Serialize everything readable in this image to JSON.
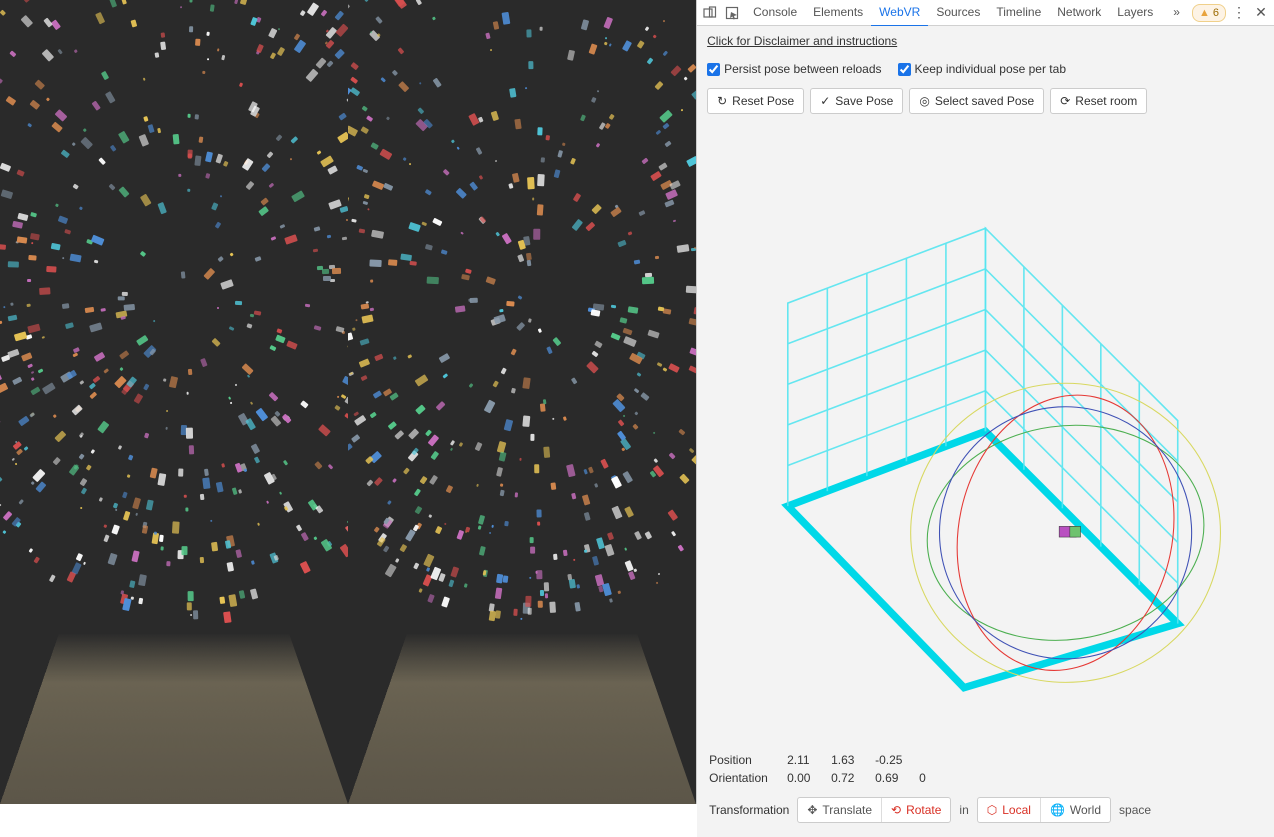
{
  "devtools": {
    "tabs": [
      "Console",
      "Elements",
      "WebVR",
      "Sources",
      "Timeline",
      "Network",
      "Layers"
    ],
    "active_tab": "WebVR",
    "overflow_glyph": "»",
    "warnings_count": "6",
    "menu_glyph": "⋮",
    "close_glyph": "✕"
  },
  "webvr": {
    "disclaimer_link": "Click for Disclaimer and instructions",
    "checkbox1": {
      "label": "Persist pose between reloads",
      "checked": true
    },
    "checkbox2": {
      "label": "Keep individual pose per tab",
      "checked": true
    },
    "buttons": {
      "reset_pose": "Reset Pose",
      "save_pose": "Save Pose",
      "select_saved_pose": "Select saved Pose",
      "reset_room": "Reset room"
    },
    "pose": {
      "position_label": "Position",
      "position": [
        "2.11",
        "1.63",
        "-0.25"
      ],
      "orientation_label": "Orientation",
      "orientation": [
        "0.00",
        "0.72",
        "0.69",
        "0"
      ]
    },
    "transform": {
      "label": "Transformation",
      "translate": "Translate",
      "rotate": "Rotate",
      "in_word": "in",
      "local": "Local",
      "world": "World",
      "space_word": "space",
      "selected_mode": "Rotate",
      "selected_space": "Local"
    }
  }
}
